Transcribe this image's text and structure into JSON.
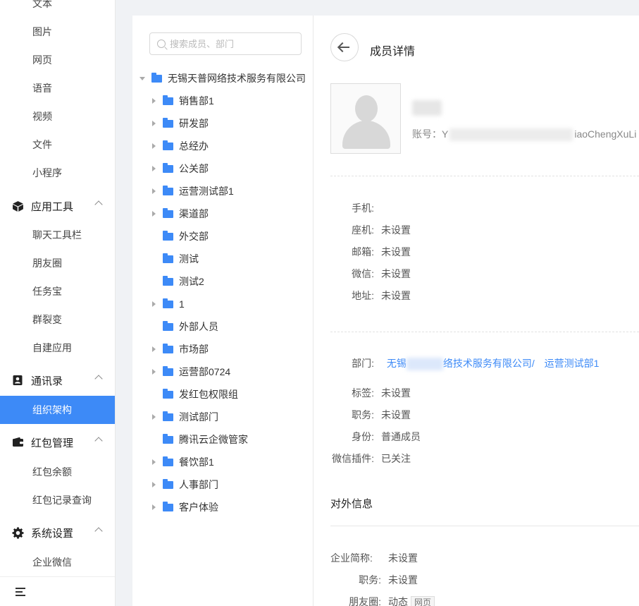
{
  "sidebar": {
    "items_top": [
      "文本",
      "图片",
      "网页",
      "语音",
      "视频",
      "文件",
      "小程序"
    ],
    "group_apps": {
      "label": "应用工具",
      "items": [
        "聊天工具栏",
        "朋友圈",
        "任务宝",
        "群裂变",
        "自建应用"
      ]
    },
    "group_contacts": {
      "label": "通讯录",
      "active_item": "组织架构"
    },
    "group_redpacket": {
      "label": "红包管理",
      "items": [
        "红包余额",
        "红包记录查询"
      ]
    },
    "group_settings": {
      "label": "系统设置",
      "items": [
        "企业微信"
      ]
    }
  },
  "tree": {
    "search_placeholder": "搜索成员、部门",
    "root": "无锡天普网络技术服务有限公司",
    "nodes": [
      {
        "label": "销售部1",
        "expandable": true
      },
      {
        "label": "研发部",
        "expandable": true
      },
      {
        "label": "总经办",
        "expandable": true
      },
      {
        "label": "公关部",
        "expandable": true
      },
      {
        "label": "运营测试部1",
        "expandable": true
      },
      {
        "label": "渠道部",
        "expandable": true
      },
      {
        "label": "外交部",
        "expandable": false
      },
      {
        "label": "测试",
        "expandable": false
      },
      {
        "label": "测试2",
        "expandable": false
      },
      {
        "label": "1",
        "expandable": true
      },
      {
        "label": "外部人员",
        "expandable": false
      },
      {
        "label": "市场部",
        "expandable": true
      },
      {
        "label": "运营部0724",
        "expandable": true
      },
      {
        "label": "发红包权限组",
        "expandable": false
      },
      {
        "label": "测试部门",
        "expandable": true
      },
      {
        "label": "腾讯云企微管家",
        "expandable": false
      },
      {
        "label": "餐饮部1",
        "expandable": true
      },
      {
        "label": "人事部门",
        "expandable": true
      },
      {
        "label": "客户体验",
        "expandable": true
      }
    ]
  },
  "detail": {
    "title": "成员详情",
    "account_label": "账号：",
    "account_prefix": "Y",
    "account_suffix": "iaoChengXuLi",
    "contact": {
      "phone_label": "手机:",
      "phone_value": "",
      "landline_label": "座机:",
      "landline_value": "未设置",
      "email_label": "邮箱:",
      "email_value": "未设置",
      "wechat_label": "微信:",
      "wechat_value": "未设置",
      "address_label": "地址:",
      "address_value": "未设置"
    },
    "org": {
      "dept_label": "部门:",
      "dept_prefix": "无锡",
      "dept_suffix": "络技术服务有限公司/",
      "dept_sub": "运营测试部1",
      "tag_label": "标签:",
      "tag_value": "未设置",
      "position_label": "职务:",
      "position_value": "未设置",
      "identity_label": "身份:",
      "identity_value": "普通成员",
      "plugin_label": "微信插件:",
      "plugin_value": "已关注"
    },
    "external": {
      "title": "对外信息",
      "company_label": "企业简称:",
      "company_value": "未设置",
      "position_label": "职务:",
      "position_value": "未设置",
      "moments_label": "朋友圈:",
      "moments_value": "动态",
      "moments_tag": "网页"
    }
  }
}
